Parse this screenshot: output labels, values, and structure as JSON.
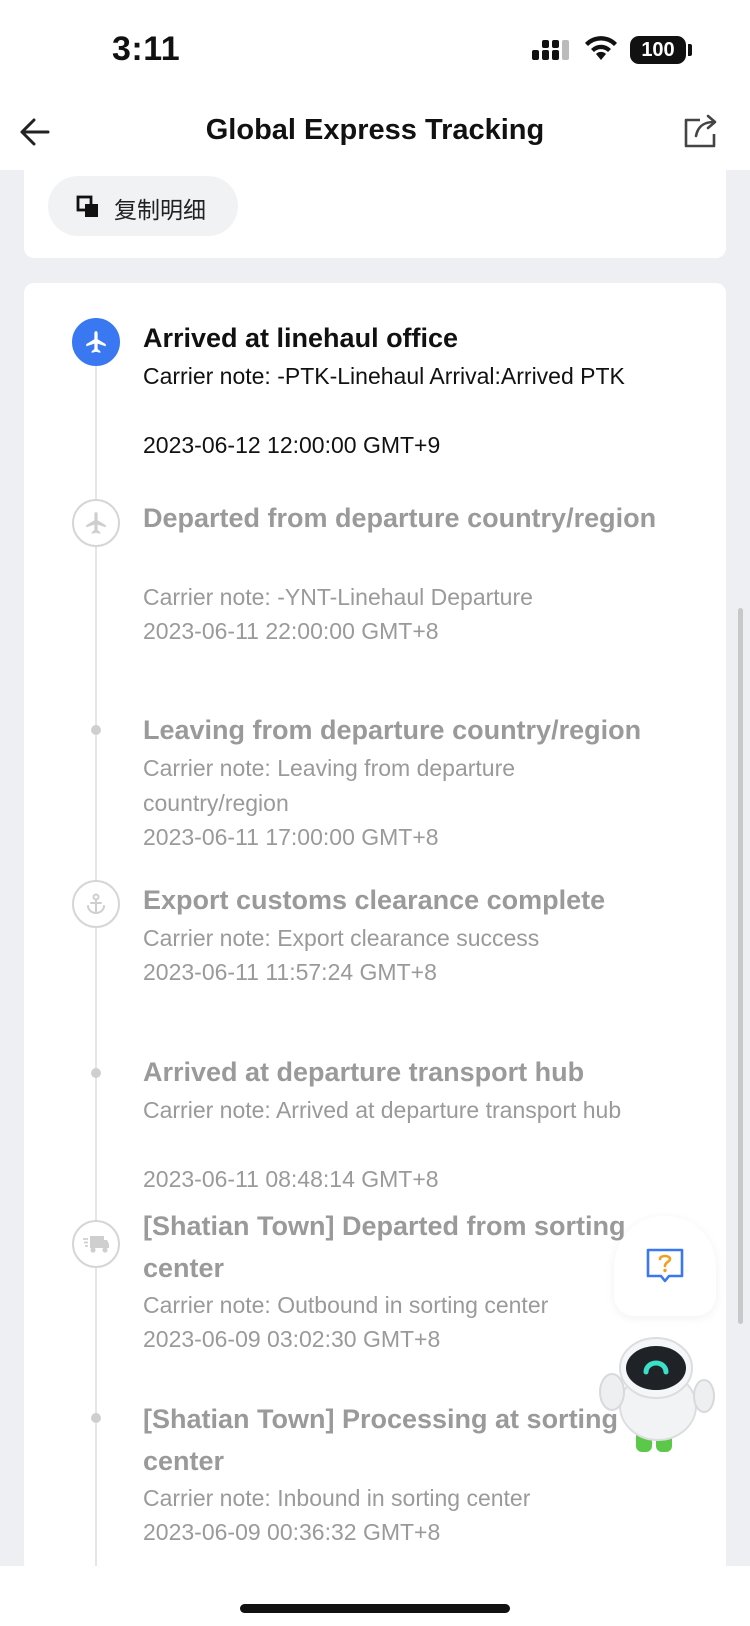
{
  "status_bar": {
    "time": "3:11",
    "battery": "100",
    "icons": [
      "signal-icon",
      "wifi-icon",
      "battery-icon"
    ]
  },
  "nav": {
    "title": "Global Express Tracking",
    "back_icon": "arrow-left-icon",
    "share_icon": "share-icon"
  },
  "copy_button": {
    "label": "复制明细",
    "icon": "copy-icon"
  },
  "events": [
    {
      "title": "Arrived at linehaul office",
      "note": "Carrier note: -PTK-Linehaul Arrival:Arrived PTK",
      "time": "2023-06-12 12:00:00 GMT+9",
      "icon": "airplane-icon",
      "active": true
    },
    {
      "title": "Departed from departure country/region",
      "note": "Carrier note: -YNT-Linehaul Departure",
      "time": "2023-06-11 22:00:00 GMT+8",
      "icon": "airplane-icon",
      "active": false
    },
    {
      "title": "Leaving from departure country/region",
      "note": "Carrier note: Leaving from departure country/region",
      "time": "2023-06-11 17:00:00 GMT+8",
      "icon": "dot",
      "active": false
    },
    {
      "title": "Export customs clearance complete",
      "note": "Carrier note: Export clearance success",
      "time": "2023-06-11 11:57:24 GMT+8",
      "icon": "anchor-icon",
      "active": false
    },
    {
      "title": "Arrived at departure transport hub",
      "note": "Carrier note: Arrived at departure transport hub",
      "time": "2023-06-11 08:48:14 GMT+8",
      "icon": "dot",
      "active": false
    },
    {
      "title": "[Shatian Town] Departed from sorting center",
      "note": "Carrier note: Outbound in sorting center",
      "time": "2023-06-09 03:02:30 GMT+8",
      "icon": "truck-icon",
      "active": false
    },
    {
      "title": "[Shatian Town] Processing at sorting center",
      "note": "Carrier note: Inbound in sorting center",
      "time": "2023-06-09 00:36:32 GMT+8",
      "icon": "dot",
      "active": false
    }
  ],
  "floating": {
    "help_icon": "question-chat-icon",
    "mascot": "robot-assistant-icon"
  },
  "colors": {
    "accent": "#3a78f2",
    "muted_text": "#9a9a9a",
    "page_bg": "#edeff3"
  }
}
